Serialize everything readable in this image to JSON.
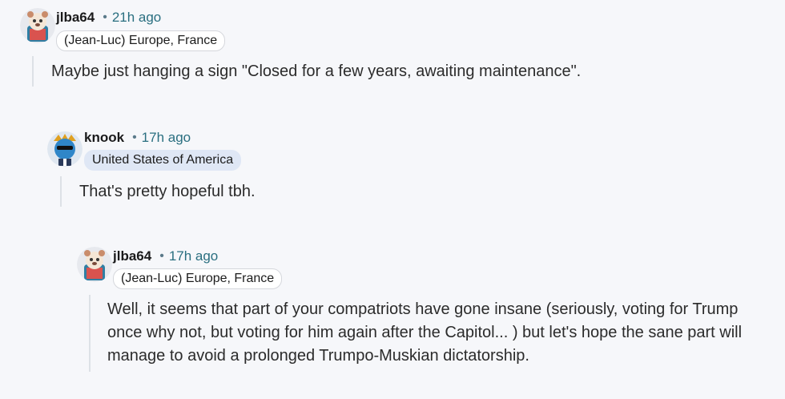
{
  "comments": [
    {
      "username": "jlba64",
      "separator": "•",
      "time": "21h ago",
      "flair": "(Jean-Luc) Europe, France",
      "body": "Maybe just hanging a sign \"Closed for a few years, awaiting maintenance\"."
    },
    {
      "username": "knook",
      "separator": "•",
      "time": "17h ago",
      "flair": "United States of America",
      "body": "That's pretty hopeful tbh."
    },
    {
      "username": "jlba64",
      "separator": "•",
      "time": "17h ago",
      "flair": "(Jean-Luc) Europe, France",
      "body": "Well, it seems that part of your compatriots have gone insane (seriously, voting for Trump once why not, but voting for him again after the Capitol... ) but let's hope the sane part will manage to avoid a prolonged Trumpo-Muskian dictatorship."
    }
  ],
  "icons": [
    "bear-avatar-icon",
    "blue-creature-avatar-icon"
  ]
}
